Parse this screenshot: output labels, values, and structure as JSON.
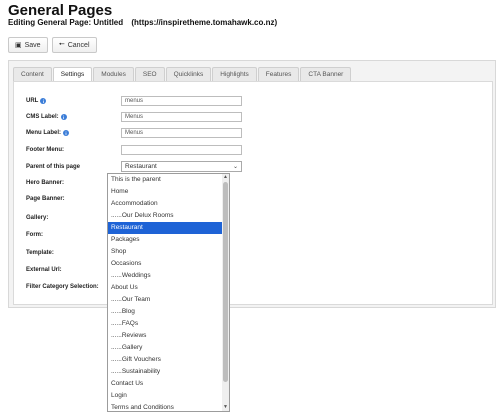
{
  "header": {
    "title": "General Pages",
    "subtitle": "Editing General Page: Untitled",
    "url": "(https://inspiretheme.tomahawk.co.nz)"
  },
  "toolbar": {
    "save_label": "Save",
    "cancel_label": "Cancel"
  },
  "tabs": [
    {
      "label": "Content",
      "active": false
    },
    {
      "label": "Settings",
      "active": true
    },
    {
      "label": "Modules",
      "active": false
    },
    {
      "label": "SEO",
      "active": false
    },
    {
      "label": "Quicklinks",
      "active": false
    },
    {
      "label": "Highlights",
      "active": false
    },
    {
      "label": "Features",
      "active": false
    },
    {
      "label": "CTA Banner",
      "active": false
    }
  ],
  "form": {
    "url": {
      "label": "URL",
      "value": "menus"
    },
    "cms_label": {
      "label": "CMS Label:",
      "value": "Menus"
    },
    "menu_label": {
      "label": "Menu Label:",
      "value": "Menus"
    },
    "footer_menu": {
      "label": "Footer Menu:",
      "value": ""
    },
    "parent": {
      "label": "Parent of this page",
      "value": "Restaurant"
    },
    "hero_banner": {
      "label": "Hero Banner:"
    },
    "page_banner": {
      "label": "Page Banner:"
    },
    "gallery": {
      "label": "Gallery:"
    },
    "form_field": {
      "label": "Form:"
    },
    "template": {
      "label": "Template:"
    },
    "external_url": {
      "label": "External Url:"
    },
    "filter_category": {
      "label": "Filter Category Selection:"
    }
  },
  "dropdown": {
    "options": [
      "This is the parent",
      "Home",
      "Accommodation",
      "......Our Delux Rooms",
      "Restaurant",
      "Packages",
      "Shop",
      "Occasions",
      "......Weddings",
      "About Us",
      "......Our Team",
      "......Blog",
      "......FAQs",
      "......Reviews",
      "......Gallery",
      "......Gift Vouchers",
      "......Sustainability",
      "Contact Us",
      "Login",
      "Terms and Conditions"
    ],
    "selected_index": 4
  },
  "colors": {
    "selected_bg": "#1e63d6",
    "info_icon": "#3b7dd8"
  }
}
